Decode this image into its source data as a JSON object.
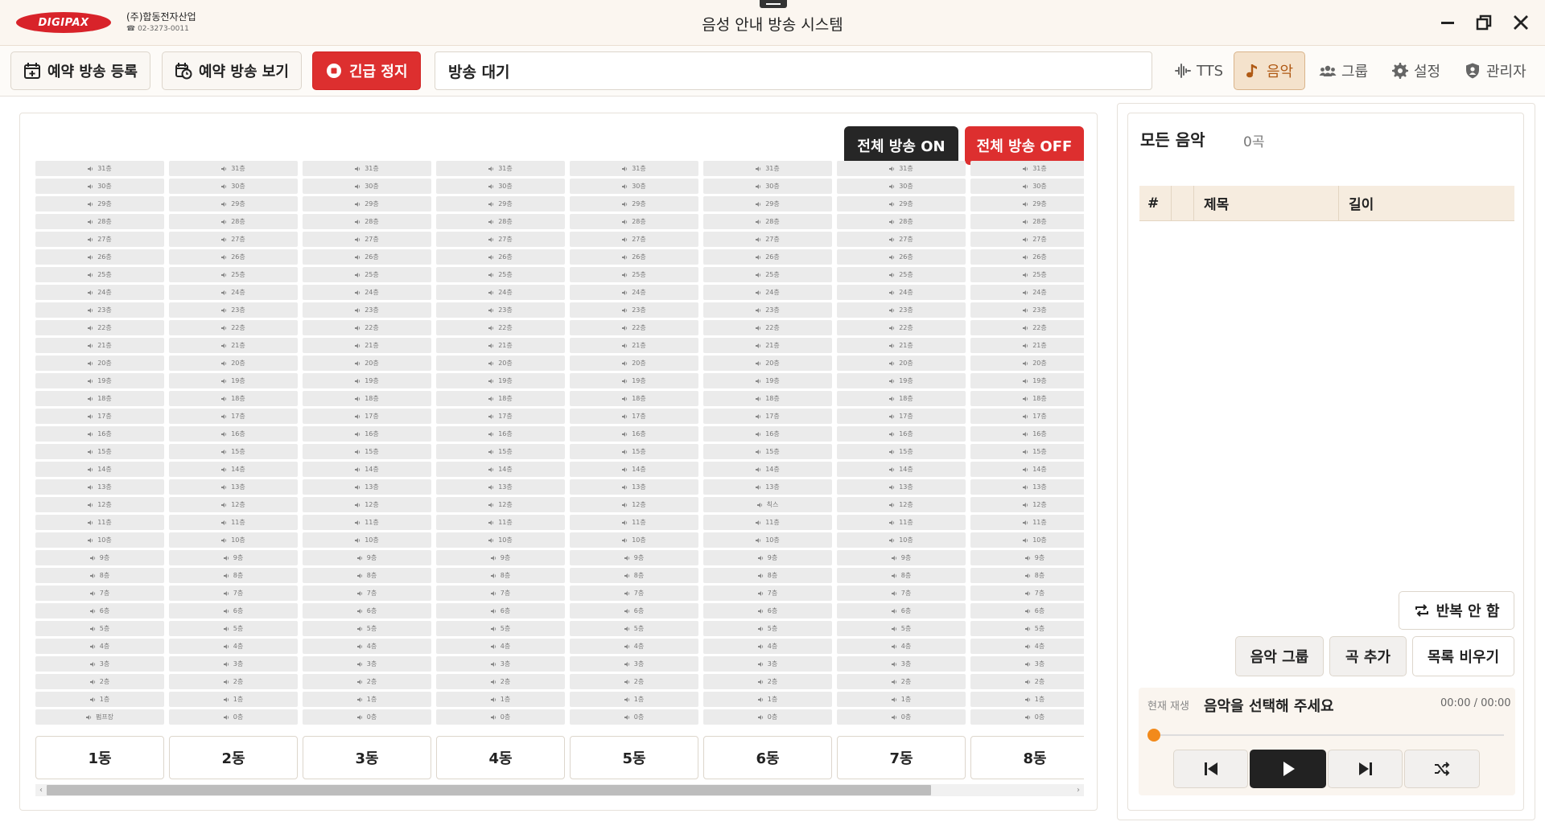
{
  "titlebar": {
    "logo_text": "DIGIPAX",
    "company_name": "(주)합동전자산업",
    "company_tel": "☎ 02-3273-0011",
    "app_title": "음성 안내 방송 시스템"
  },
  "toolbar": {
    "schedule_register": "예약 방송 등록",
    "schedule_view": "예약 방송 보기",
    "emergency_stop": "긴급 정지",
    "status": "방송 대기",
    "nav": [
      {
        "label": "TTS",
        "icon": "waveform-icon",
        "active": false
      },
      {
        "label": "음악",
        "icon": "music-note-icon",
        "active": true
      },
      {
        "label": "그룹",
        "icon": "group-icon",
        "active": false
      },
      {
        "label": "설정",
        "icon": "gear-icon",
        "active": false
      },
      {
        "label": "관리자",
        "icon": "user-shield-icon",
        "active": false
      }
    ]
  },
  "broadcast": {
    "all_on": "전체 방송 ON",
    "all_off": "전체 방송 OFF",
    "buildings": [
      {
        "name": "1동",
        "floors": [
          "31층",
          "30층",
          "29층",
          "28층",
          "27층",
          "26층",
          "25층",
          "24층",
          "23층",
          "22층",
          "21층",
          "20층",
          "19층",
          "18층",
          "17층",
          "16층",
          "15층",
          "14층",
          "13층",
          "12층",
          "11층",
          "10층",
          "9층",
          "8층",
          "7층",
          "6층",
          "5층",
          "4층",
          "3층",
          "2층",
          "1층",
          "펌프장"
        ]
      },
      {
        "name": "2동",
        "floors": [
          "31층",
          "30층",
          "29층",
          "28층",
          "27층",
          "26층",
          "25층",
          "24층",
          "23층",
          "22층",
          "21층",
          "20층",
          "19층",
          "18층",
          "17층",
          "16층",
          "15층",
          "14층",
          "13층",
          "12층",
          "11층",
          "10층",
          "9층",
          "8층",
          "7층",
          "6층",
          "5층",
          "4층",
          "3층",
          "2층",
          "1층",
          "0층"
        ]
      },
      {
        "name": "3동",
        "floors": [
          "31층",
          "30층",
          "29층",
          "28층",
          "27층",
          "26층",
          "25층",
          "24층",
          "23층",
          "22층",
          "21층",
          "20층",
          "19층",
          "18층",
          "17층",
          "16층",
          "15층",
          "14층",
          "13층",
          "12층",
          "11층",
          "10층",
          "9층",
          "8층",
          "7층",
          "6층",
          "5층",
          "4층",
          "3층",
          "2층",
          "1층",
          "0층"
        ]
      },
      {
        "name": "4동",
        "floors": [
          "31층",
          "30층",
          "29층",
          "28층",
          "27층",
          "26층",
          "25층",
          "24층",
          "23층",
          "22층",
          "21층",
          "20층",
          "19층",
          "18층",
          "17층",
          "16층",
          "15층",
          "14층",
          "13층",
          "12층",
          "11층",
          "10층",
          "9층",
          "8층",
          "7층",
          "6층",
          "5층",
          "4층",
          "3층",
          "2층",
          "1층",
          "0층"
        ]
      },
      {
        "name": "5동",
        "floors": [
          "31층",
          "30층",
          "29층",
          "28층",
          "27층",
          "26층",
          "25층",
          "24층",
          "23층",
          "22층",
          "21층",
          "20층",
          "19층",
          "18층",
          "17층",
          "16층",
          "15층",
          "14층",
          "13층",
          "12층",
          "11층",
          "10층",
          "9층",
          "8층",
          "7층",
          "6층",
          "5층",
          "4층",
          "3층",
          "2층",
          "1층",
          "0층"
        ]
      },
      {
        "name": "6동",
        "floors": [
          "31층",
          "30층",
          "29층",
          "28층",
          "27층",
          "26층",
          "25층",
          "24층",
          "23층",
          "22층",
          "21층",
          "20층",
          "19층",
          "18층",
          "17층",
          "16층",
          "15층",
          "14층",
          "13층",
          "칙스",
          "11층",
          "10층",
          "9층",
          "8층",
          "7층",
          "6층",
          "5층",
          "4층",
          "3층",
          "2층",
          "1층",
          "0층"
        ]
      },
      {
        "name": "7동",
        "floors": [
          "31층",
          "30층",
          "29층",
          "28층",
          "27층",
          "26층",
          "25층",
          "24층",
          "23층",
          "22층",
          "21층",
          "20층",
          "19층",
          "18층",
          "17층",
          "16층",
          "15층",
          "14층",
          "13층",
          "12층",
          "11층",
          "10층",
          "9층",
          "8층",
          "7층",
          "6층",
          "5층",
          "4층",
          "3층",
          "2층",
          "1층",
          "0층"
        ]
      },
      {
        "name": "8동",
        "floors": [
          "31층",
          "30층",
          "29층",
          "28층",
          "27층",
          "26층",
          "25층",
          "24층",
          "23층",
          "22층",
          "21층",
          "20층",
          "19층",
          "18층",
          "17층",
          "16층",
          "15층",
          "14층",
          "13층",
          "12층",
          "11층",
          "10층",
          "9층",
          "8층",
          "7층",
          "6층",
          "5층",
          "4층",
          "3층",
          "2층",
          "1층",
          "0층"
        ]
      }
    ]
  },
  "music": {
    "title": "모든 음악",
    "count": "0곡",
    "columns": [
      "#",
      "",
      "제목",
      "길이"
    ],
    "repeat_label": "반복 안 함",
    "music_group": "음악 그룹",
    "add_song": "곡 추가",
    "clear_list": "목록 비우기",
    "now_playing_label": "현재 재생",
    "now_playing_text": "음악을 선택해 주세요",
    "time": "00:00 / 00:00",
    "progress": 0
  },
  "colors": {
    "accent_red": "#dd2f2f",
    "accent_orange": "#f28a1b",
    "active_nav_bg": "#f4e2cc",
    "dark_button": "#262626"
  }
}
